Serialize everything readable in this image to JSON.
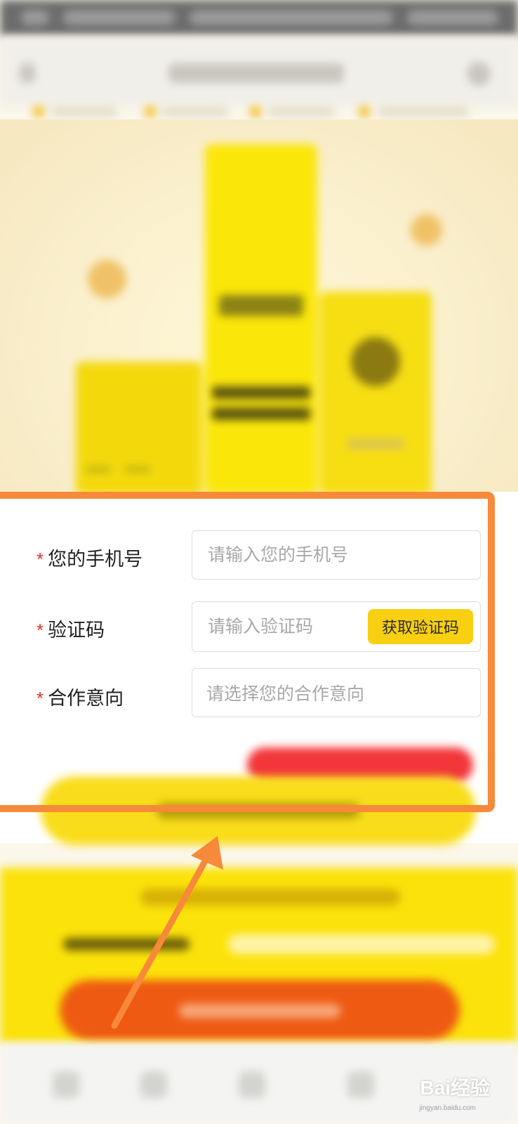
{
  "form": {
    "phone": {
      "label": "您的手机号",
      "placeholder": "请输入您的手机号"
    },
    "code": {
      "label": "验证码",
      "placeholder": "请输入验证码",
      "button": "获取验证码"
    },
    "intent": {
      "label": "合作意向",
      "placeholder": "请选择您的合作意向"
    },
    "required_mark": "*"
  },
  "watermark": {
    "brand": "Bai经验",
    "url": "jingyan.baidu.com"
  },
  "colors": {
    "accent_yellow": "#f9cf12",
    "highlight_orange": "#f7893b",
    "required_red": "#e0322f"
  }
}
